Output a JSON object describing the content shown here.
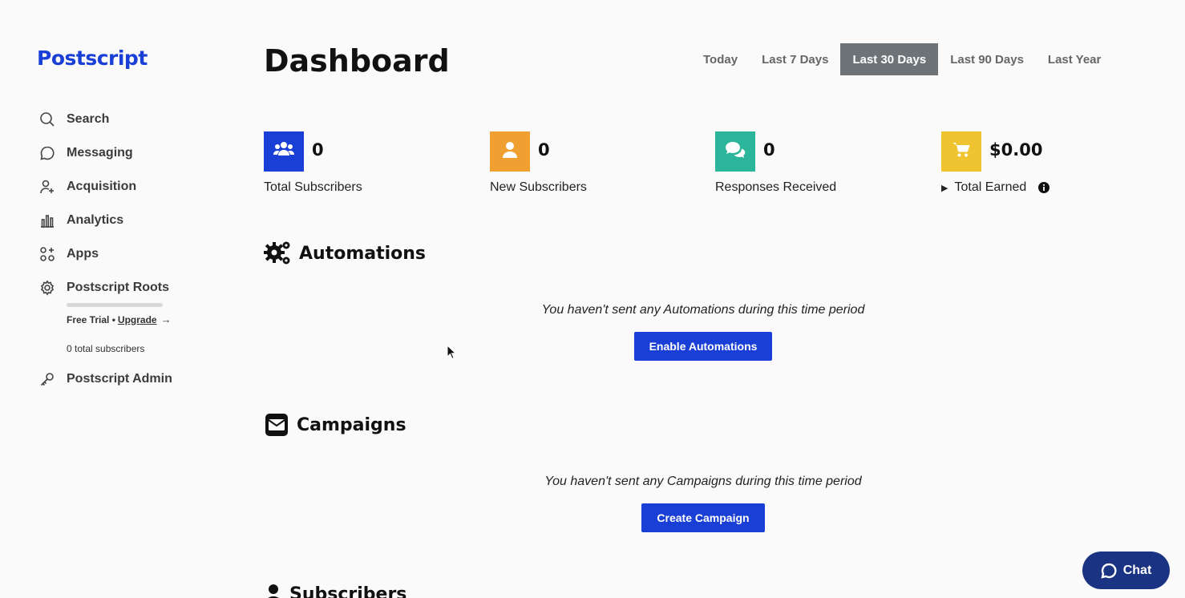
{
  "brand": {
    "logo": "Postscript",
    "accent": "#1a3fd6"
  },
  "sidebar": {
    "items": [
      {
        "label": "Search",
        "icon": "search-icon"
      },
      {
        "label": "Messaging",
        "icon": "chat-bubble-icon"
      },
      {
        "label": "Acquisition",
        "icon": "user-plus-icon"
      },
      {
        "label": "Analytics",
        "icon": "bar-chart-icon"
      },
      {
        "label": "Apps",
        "icon": "apps-grid-icon"
      },
      {
        "label": "Postscript Roots",
        "icon": "gear-icon"
      },
      {
        "label": "Postscript Admin",
        "icon": "key-icon"
      }
    ],
    "roots": {
      "progress": 0,
      "trial_label": "Free Trial •",
      "upgrade_label": "Upgrade",
      "subscribers_text": "0 total subscribers"
    }
  },
  "header": {
    "title": "Dashboard",
    "ranges": [
      "Today",
      "Last 7 Days",
      "Last 30 Days",
      "Last 90 Days",
      "Last Year"
    ],
    "active_range": "Last 30 Days"
  },
  "stats": [
    {
      "value": "0",
      "label": "Total Subscribers",
      "color": "#1a3fd6",
      "icon": "users-icon"
    },
    {
      "value": "0",
      "label": "New Subscribers",
      "color": "#f0a030",
      "icon": "user-icon"
    },
    {
      "value": "0",
      "label": "Responses Received",
      "color": "#2bb59a",
      "icon": "comments-icon"
    },
    {
      "value": "$0.00",
      "label": "Total Earned",
      "color": "#f0c430",
      "icon": "cart-icon"
    }
  ],
  "automations": {
    "title": "Automations",
    "empty_text": "You haven't sent any Automations during this time period",
    "button": "Enable Automations"
  },
  "campaigns": {
    "title": "Campaigns",
    "empty_text": "You haven't sent any Campaigns during this time period",
    "button": "Create Campaign"
  },
  "subscribers": {
    "title": "Subscribers"
  },
  "chat": {
    "label": "Chat"
  }
}
